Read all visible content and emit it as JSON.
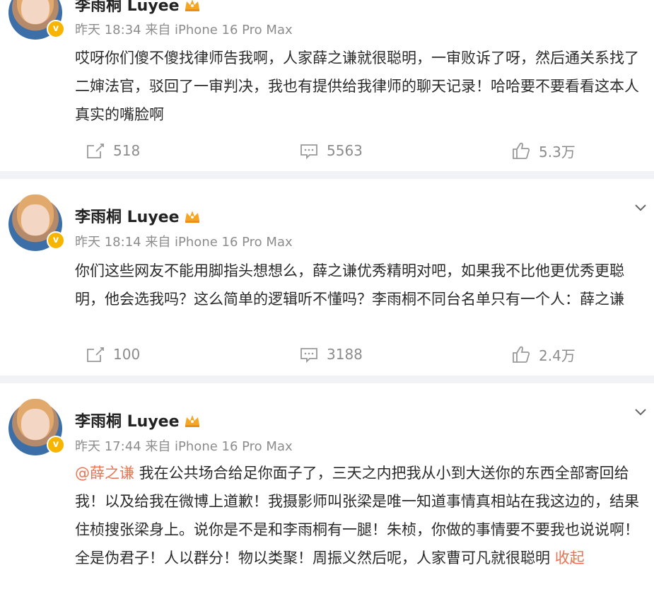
{
  "posts": [
    {
      "name": "李雨桐 Luyee",
      "meta": "昨天 18:34 来自 iPhone 16 Pro Max",
      "text": "哎呀你们傻不傻找律师告我啊，人家薛之谦就很聪明，一审败诉了呀，然后通关系找了二婶法官，驳回了一审判决，我也有提供给我律师的聊天记录！哈哈要不要看看这本人真实的嘴脸啊",
      "reposts": "518",
      "comments": "5563",
      "likes": "5.3万"
    },
    {
      "name": "李雨桐 Luyee",
      "meta": "昨天 18:14 来自 iPhone 16 Pro Max",
      "text": "你们这些网友不能用脚指头想想么，薛之谦优秀精明对吧，如果我不比他更优秀更聪明，他会选我吗？这么简单的逻辑听不懂吗？李雨桐不同台名单只有一个人：薛之谦",
      "reposts": "100",
      "comments": "3188",
      "likes": "2.4万"
    },
    {
      "name": "李雨桐 Luyee",
      "meta": "昨天 17:44 来自 iPhone 16 Pro Max",
      "mention": "@薛之谦",
      "text": " 我在公共场合给足你面子了，三天之内把我从小到大送你的东西全部寄回给我！以及给我在微博上道歉！我摄影师叫张梁是唯一知道事情真相站在我这边的，结果住桢搜张梁身上。说你是不是和李雨桐有一腿！朱桢，你做的事情要不要我也说说啊！全是伪君子！人以群分！物以类聚！周振义然后呢，人家曹可凡就很聪明",
      "collapse": "收起"
    }
  ],
  "colors": {
    "accent": "#eb7350",
    "meta": "#8c8c8c",
    "separator": "#f1f2f5",
    "verified": "#f7b500"
  },
  "icons": [
    "repost-icon",
    "comment-icon",
    "like-icon",
    "chevron-down-icon",
    "crown-icon",
    "verified-icon"
  ]
}
